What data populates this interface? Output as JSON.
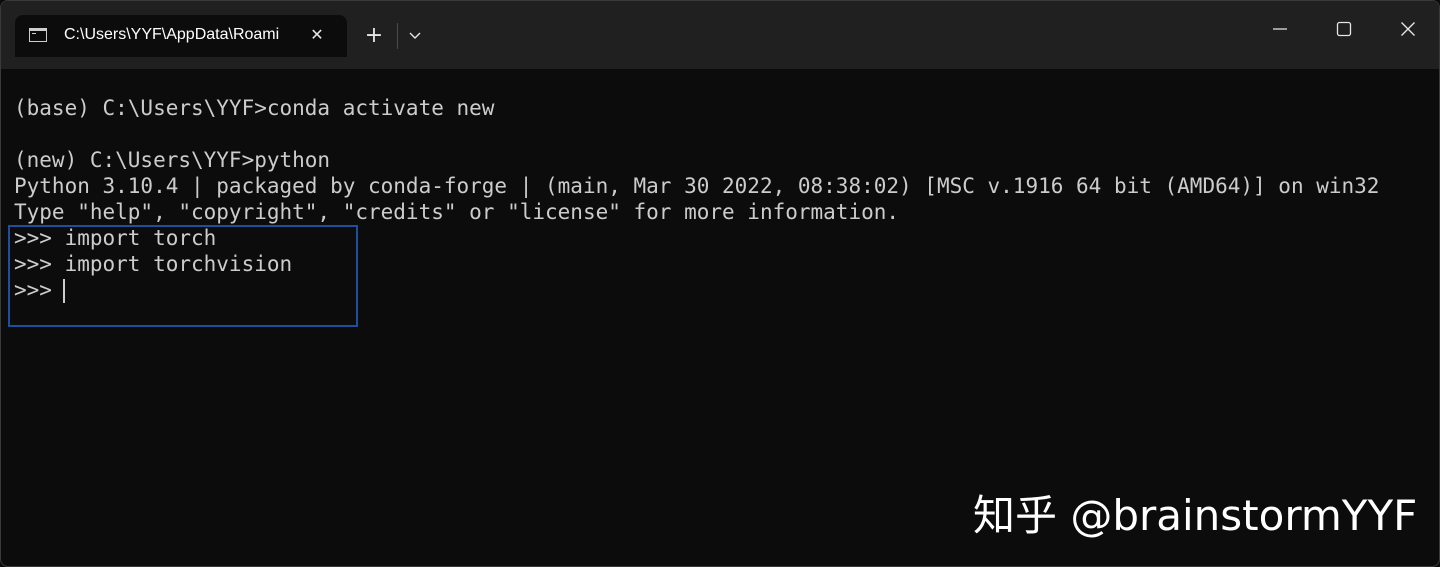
{
  "tab": {
    "title": "C:\\Users\\YYF\\AppData\\Roami",
    "close_glyph": "✕",
    "icon": "terminal-icon"
  },
  "tabbar": {
    "new_tab_glyph": "+",
    "dropdown_icon": "chevron-down-icon"
  },
  "window_controls": {
    "minimize_icon": "minimize-icon",
    "maximize_icon": "maximize-icon",
    "close_icon": "close-icon"
  },
  "terminal": {
    "lines": [
      "(base) C:\\Users\\YYF>conda activate new",
      "",
      "(new) C:\\Users\\YYF>python",
      "Python 3.10.4 | packaged by conda-forge | (main, Mar 30 2022, 08:38:02) [MSC v.1916 64 bit (AMD64)] on win32",
      "Type \"help\", \"copyright\", \"credits\" or \"license\" for more information.",
      ">>> import torch",
      ">>> import torchvision",
      ">>> "
    ]
  },
  "watermark": {
    "text": "知乎 @brainstormYYF"
  },
  "colors": {
    "background": "#0c0c0c",
    "titlebar": "#202020",
    "text": "#cccccc",
    "highlight": "#1d4f9c"
  }
}
